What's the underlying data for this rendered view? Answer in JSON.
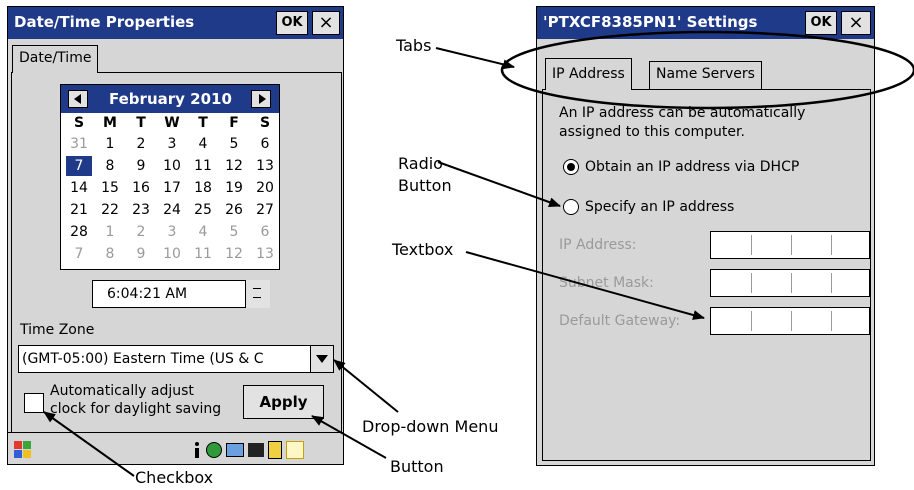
{
  "left_window": {
    "title": "Date/Time Properties",
    "ok_label": "OK",
    "close_label": "×",
    "tab_label": "Date/Time",
    "calendar": {
      "month_label": "February 2010",
      "weekdays": [
        "S",
        "M",
        "T",
        "W",
        "T",
        "F",
        "S"
      ],
      "weeks": [
        [
          "31",
          "1",
          "2",
          "3",
          "4",
          "5",
          "6"
        ],
        [
          "7",
          "8",
          "9",
          "10",
          "11",
          "12",
          "13"
        ],
        [
          "14",
          "15",
          "16",
          "17",
          "18",
          "19",
          "20"
        ],
        [
          "21",
          "22",
          "23",
          "24",
          "25",
          "26",
          "27"
        ],
        [
          "28",
          "1",
          "2",
          "3",
          "4",
          "5",
          "6"
        ],
        [
          "7",
          "8",
          "9",
          "10",
          "11",
          "12",
          "13"
        ]
      ],
      "selected_day": "7"
    },
    "time_value": "6:04:21 AM",
    "timezone_label": "Time Zone",
    "timezone_value": "(GMT-05:00) Eastern Time (US & C",
    "checkbox_line1": "Automatically adjust",
    "checkbox_line2": "clock for daylight saving",
    "apply_label": "Apply"
  },
  "right_window": {
    "title": "'PTXCF8385PN1' Settings",
    "ok_label": "OK",
    "close_label": "×",
    "tabs": [
      "IP Address",
      "Name Servers"
    ],
    "description_line1": "An IP address can be automatically",
    "description_line2": "assigned to this computer.",
    "radio_dhcp_label": "Obtain an IP address via DHCP",
    "radio_specify_label": "Specify an IP address",
    "fields": [
      "IP Address:",
      "Subnet Mask:",
      "Default Gateway:"
    ]
  },
  "callouts": {
    "tabs": "Tabs",
    "radio_line1": "Radio",
    "radio_line2": "Button",
    "textbox": "Textbox",
    "dropdown": "Drop-down Menu",
    "button": "Button",
    "checkbox": "Checkbox"
  },
  "colors": {
    "titlebar": "#203a8a",
    "window_body": "#d6d6d6",
    "disabled_text": "#9a9a9a"
  }
}
